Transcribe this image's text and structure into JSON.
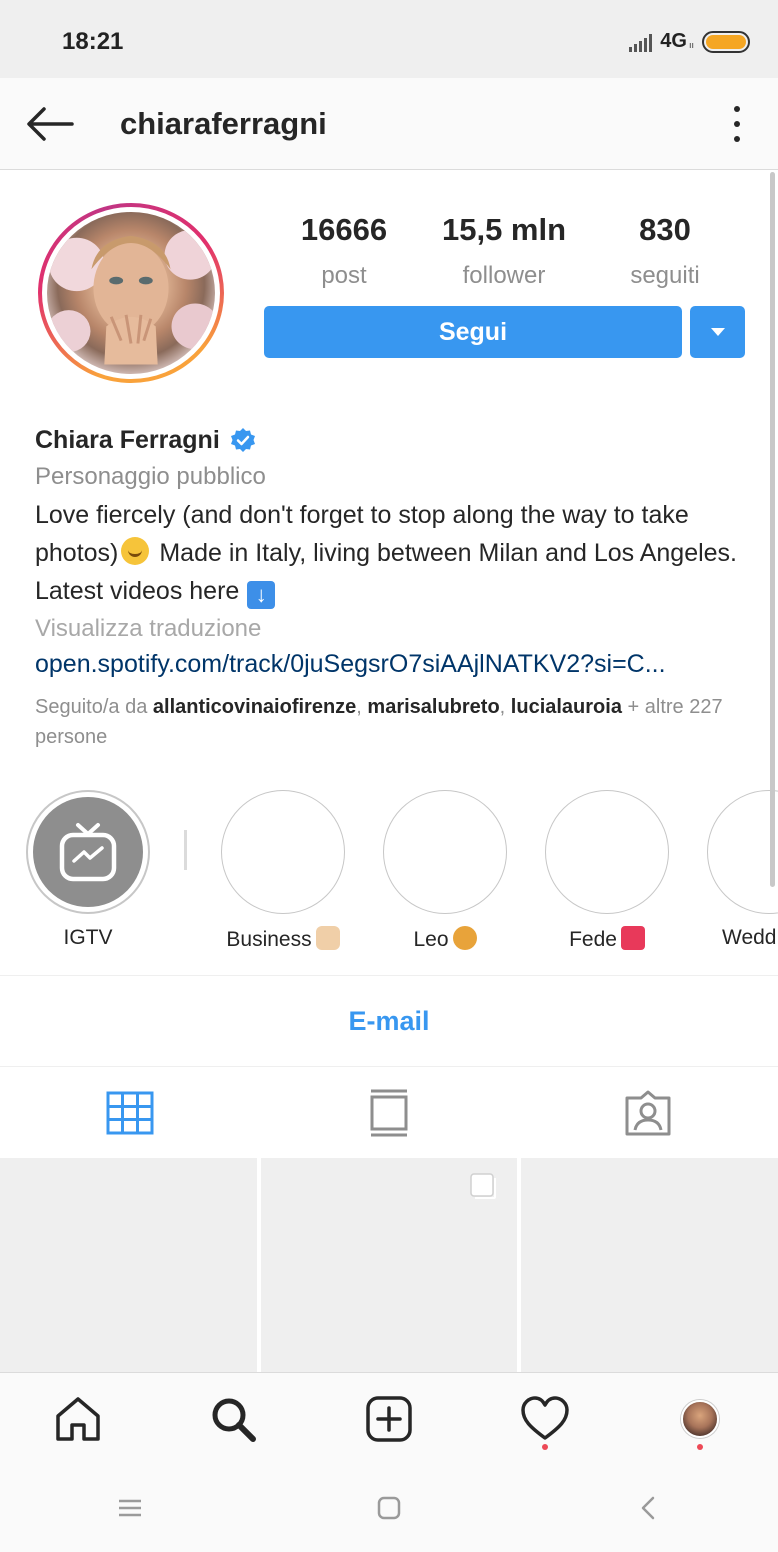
{
  "status_bar": {
    "time": "18:21",
    "network": "4G",
    "network_sub": "ıı",
    "battery_color": "#f5a623"
  },
  "header": {
    "username": "chiaraferragni",
    "back_icon": "arrow-left-icon",
    "more_icon": "more-vertical-icon"
  },
  "stats": {
    "posts_value": "16666",
    "posts_label": "post",
    "followers_value": "15,5 mln",
    "followers_label": "follower",
    "following_value": "830",
    "following_label": "seguiti"
  },
  "actions": {
    "follow_label": "Segui",
    "accent_color": "#3897f0"
  },
  "bio": {
    "full_name": "Chiara Ferragni",
    "category": "Personaggio pubblico",
    "text_part1": "Love fiercely (and don't forget to stop along the way to take photos)",
    "text_part2": "Made in Italy, living between Milan and Los Angeles. Latest videos here",
    "translate": "Visualizza traduzione",
    "link": "open.spotify.com/track/0juSegsrO7siAAjlNATKV2?si=C...",
    "followed_prefix": "Seguito/a da",
    "followed_user1": "allanticovinaiofirenze",
    "followed_user2": "marisalubreto",
    "followed_user3": "lucialauroia",
    "followed_suffix": "+ altre 227 persone"
  },
  "highlights": [
    {
      "label": "IGTV"
    },
    {
      "label": "Business"
    },
    {
      "label": "Leo"
    },
    {
      "label": "Fede"
    },
    {
      "label": "Wedd"
    }
  ],
  "contact": {
    "email_label": "E-mail"
  },
  "tabs": [
    {
      "icon": "grid-icon",
      "active": true
    },
    {
      "icon": "feed-icon",
      "active": false
    },
    {
      "icon": "tagged-icon",
      "active": false
    }
  ],
  "bottom_nav": [
    {
      "icon": "home-icon"
    },
    {
      "icon": "search-icon"
    },
    {
      "icon": "add-post-icon"
    },
    {
      "icon": "heart-icon"
    },
    {
      "icon": "profile-avatar-icon"
    }
  ],
  "system_nav": [
    {
      "icon": "menu-icon"
    },
    {
      "icon": "home-square-icon"
    },
    {
      "icon": "back-chevron-icon"
    }
  ]
}
